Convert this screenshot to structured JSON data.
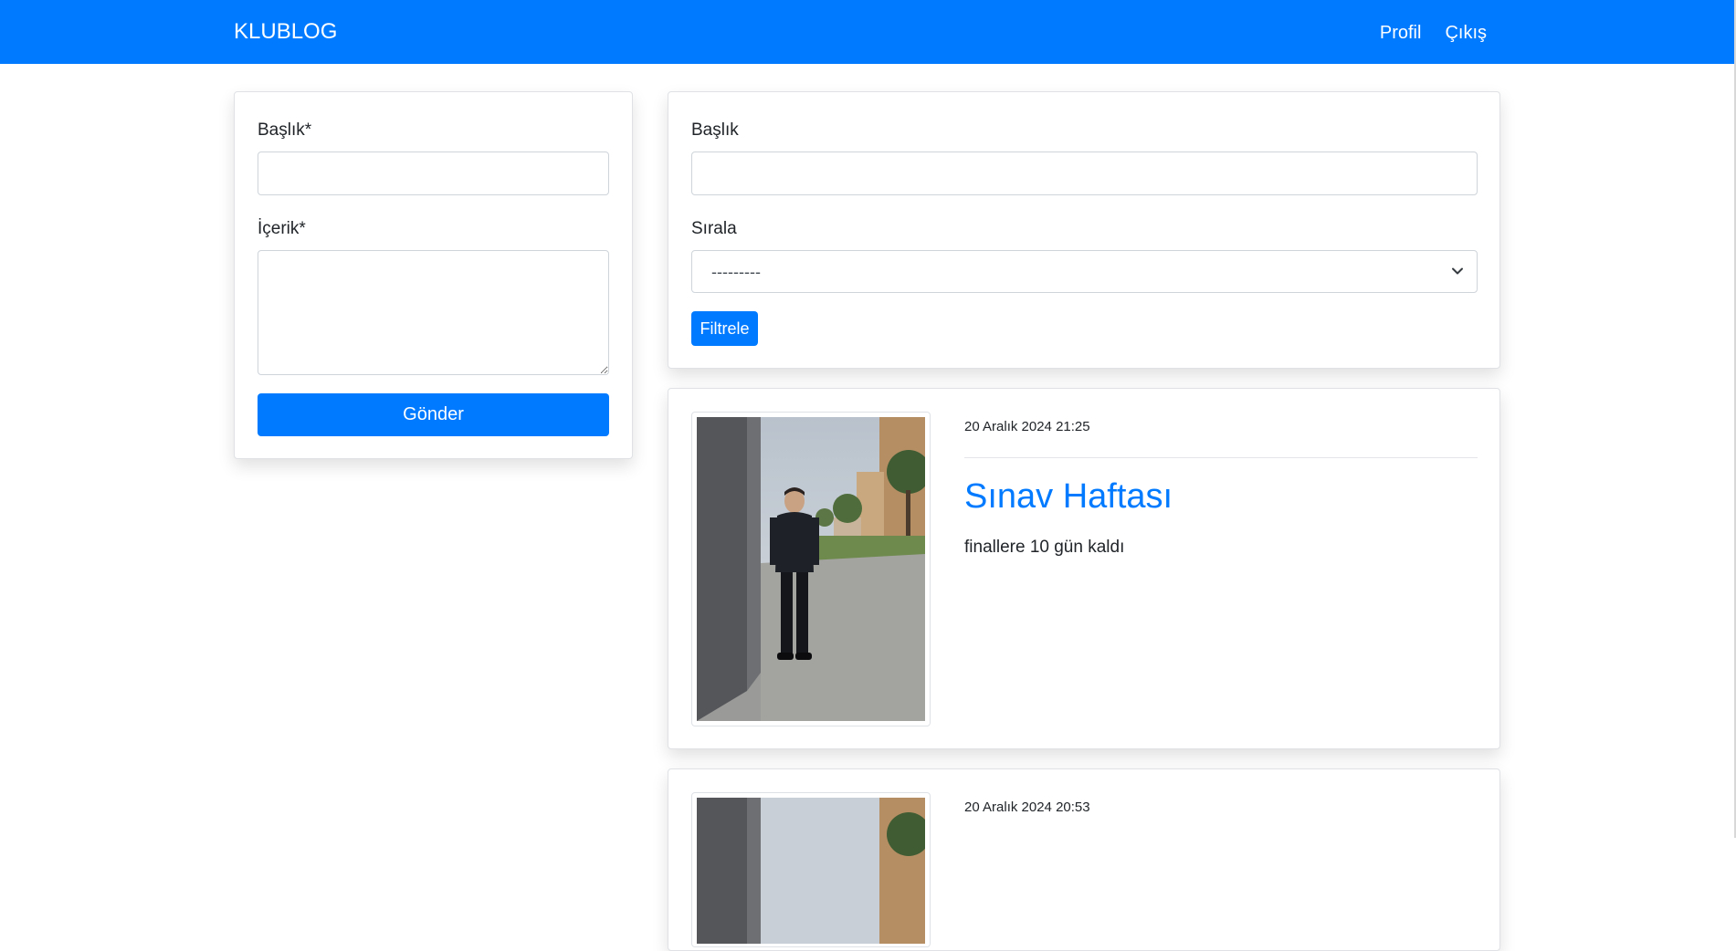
{
  "navbar": {
    "brand": "KLUBLOG",
    "links": [
      "Profil",
      "Çıkış"
    ]
  },
  "create_form": {
    "title_label": "Başlık*",
    "title_value": "",
    "content_label": "İçerik*",
    "content_value": "",
    "submit_label": "Gönder"
  },
  "filter_form": {
    "title_label": "Başlık",
    "title_value": "",
    "sort_label": "Sırala",
    "sort_selected": "---------",
    "filter_button": "Filtrele"
  },
  "posts": [
    {
      "date": "20 Aralık 2024 21:25",
      "title": "Sınav Haftası",
      "body": "finallere 10 gün kaldı"
    },
    {
      "date": "20 Aralık 2024 20:53"
    }
  ],
  "colors": {
    "primary": "#007bff",
    "text": "#212529",
    "border": "#ced4da"
  }
}
